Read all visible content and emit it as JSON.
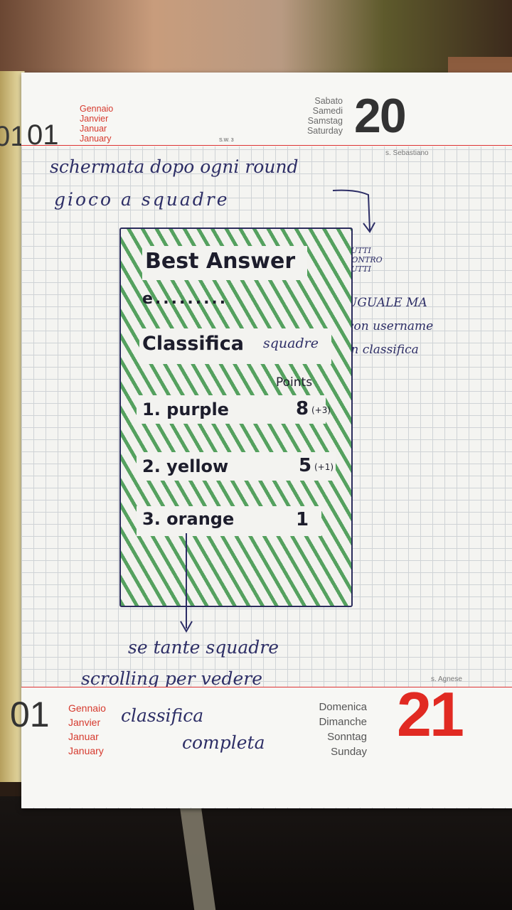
{
  "calendar": {
    "month_number": "01",
    "months": [
      "Gennaio",
      "Janvier",
      "Januar",
      "January"
    ],
    "week_label": "S.W. 3",
    "day1": {
      "days": [
        "Sabato",
        "Samedi",
        "Samstag",
        "Saturday"
      ],
      "number": "20",
      "saint": "s. Sebastiano"
    },
    "day2": {
      "days": [
        "Domenica",
        "Dimanche",
        "Sonntag",
        "Sunday"
      ],
      "number": "21",
      "saint": "s. Agnese"
    }
  },
  "notes": {
    "line1": "schermata dopo ogni round",
    "line2": "gioco a squadre",
    "side_top": [
      "TUTTI",
      "CONTRO",
      "TUTTI"
    ],
    "side_bottom": [
      "UGUALE MA",
      "con username",
      "in classifica"
    ],
    "bottom": [
      "se tante squadre",
      "scrolling per vedere",
      "classifica",
      "completa"
    ]
  },
  "sketch": {
    "title": "Best Answer",
    "answer": "e.........",
    "ranking_title": "Classifica",
    "ranking_sub": "squadre",
    "points_header": "Points",
    "rows": [
      {
        "label": "1. purple",
        "points": "8",
        "delta": "(+3)"
      },
      {
        "label": "2. yellow",
        "points": "5",
        "delta": "(+1)"
      },
      {
        "label": "3. orange",
        "points": "1",
        "delta": ""
      }
    ],
    "accent_color": "#2e8a3c"
  }
}
